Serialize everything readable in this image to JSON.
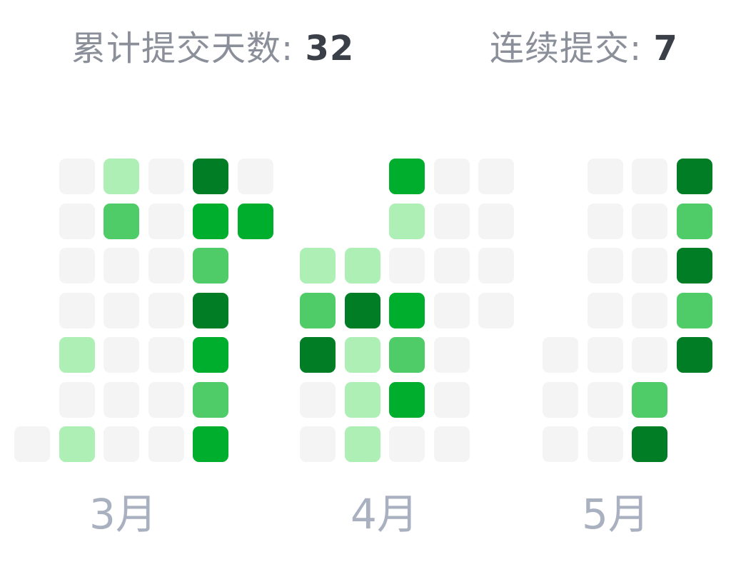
{
  "stats": {
    "total_label": "累计提交天数:",
    "total_value": "32",
    "streak_label": "连续提交:",
    "streak_value": "7"
  },
  "colors": {
    "0": "#f4f4f4",
    "1": "#aeefb6",
    "2": "#4fcc68",
    "3": "#00ae2e",
    "4": "#007d25"
  },
  "months": [
    {
      "label": "3月",
      "weeks": [
        [
          null,
          null,
          null,
          null,
          null,
          null,
          0
        ],
        [
          0,
          0,
          0,
          0,
          1,
          0,
          1
        ],
        [
          1,
          2,
          0,
          0,
          0,
          0,
          0
        ],
        [
          0,
          0,
          0,
          0,
          0,
          0,
          0
        ],
        [
          4,
          3,
          2,
          4,
          3,
          2,
          3
        ],
        [
          0,
          3,
          null,
          null,
          null,
          null,
          null
        ]
      ]
    },
    {
      "label": "4月",
      "weeks": [
        [
          null,
          null,
          1,
          2,
          4,
          0,
          0
        ],
        [
          null,
          null,
          1,
          4,
          1,
          1,
          1
        ],
        [
          3,
          1,
          0,
          3,
          2,
          3,
          0
        ],
        [
          0,
          0,
          0,
          0,
          0,
          0,
          0
        ],
        [
          0,
          0,
          0,
          0,
          null,
          null,
          null
        ]
      ]
    },
    {
      "label": "5月",
      "weeks": [
        [
          null,
          null,
          null,
          null,
          0,
          0,
          0
        ],
        [
          0,
          0,
          0,
          0,
          0,
          0,
          0
        ],
        [
          0,
          0,
          0,
          0,
          0,
          2,
          4
        ],
        [
          4,
          2,
          4,
          2,
          4,
          null,
          null
        ]
      ]
    }
  ]
}
